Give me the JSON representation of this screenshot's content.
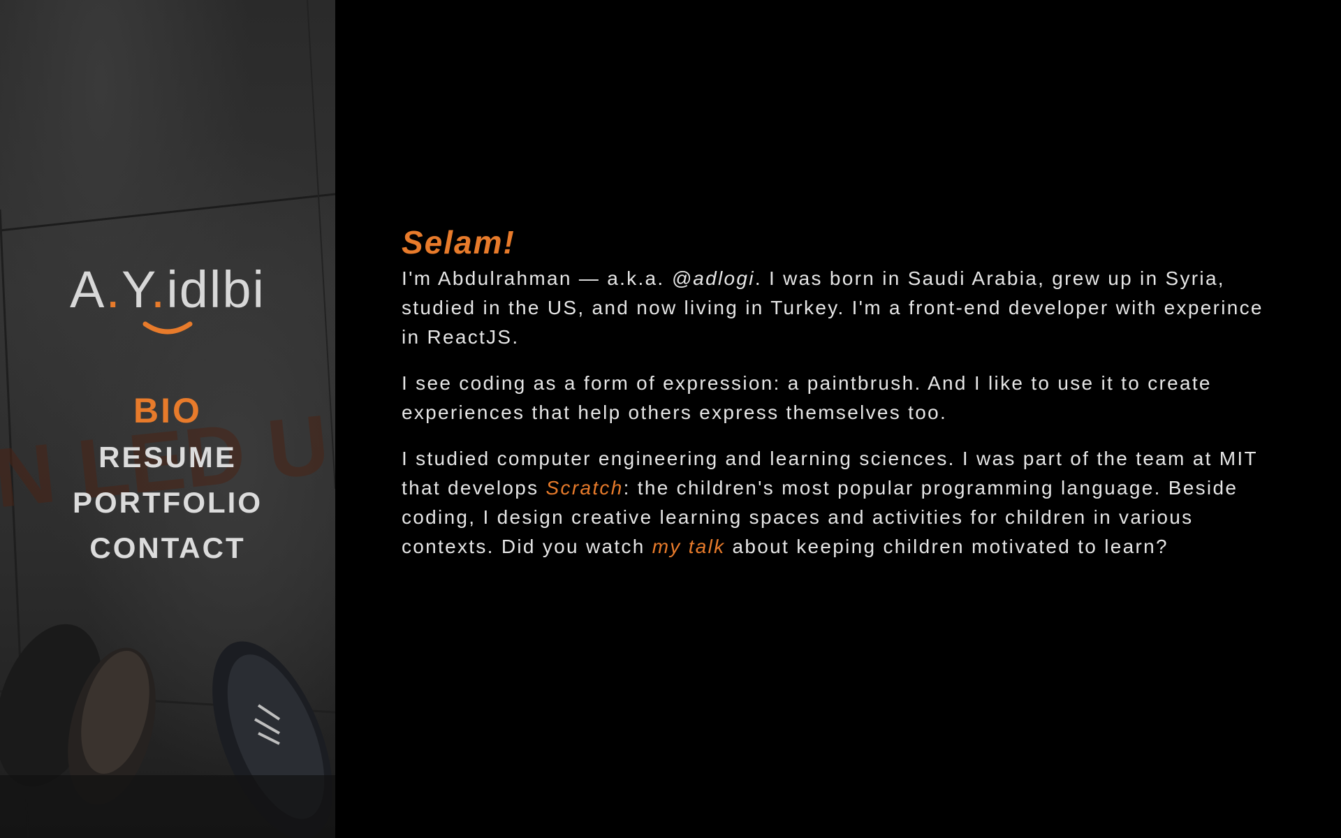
{
  "sidebar": {
    "logo": {
      "part1": "A",
      "dot1": ".",
      "part2": "Y",
      "dot2": ".",
      "part3": "idlbi"
    },
    "nav": [
      {
        "label": "BIO",
        "active": true
      },
      {
        "label": "RESUME",
        "active": false
      },
      {
        "label": "PORTFOLIO",
        "active": false
      },
      {
        "label": "CONTACT",
        "active": false
      }
    ]
  },
  "main": {
    "greeting": "Selam!",
    "p1": {
      "before": "I'm Abdulrahman — a.k.a. ",
      "handle": "@adlogi",
      "after": ". I was born in Saudi Arabia, grew up in Syria, studied in the US, and now living in Turkey. I'm a front-end developer with experince in ReactJS."
    },
    "p2": "I see coding as a form of expression: a paintbrush. And I like to use it to create experiences that help others express themselves too.",
    "p3": {
      "before": "I studied computer engineering and learning sciences. I was part of the team at MIT that develops ",
      "scratch": "Scratch",
      "middle": ": the children's most popular programming language. Beside coding, I design creative learning spaces and activities for children in various contexts. Did you watch ",
      "talk": "my talk",
      "after": " about keeping children motivated to learn?"
    }
  },
  "colors": {
    "accent": "#e87b2b",
    "background": "#000000",
    "text": "#e6e6e6"
  }
}
